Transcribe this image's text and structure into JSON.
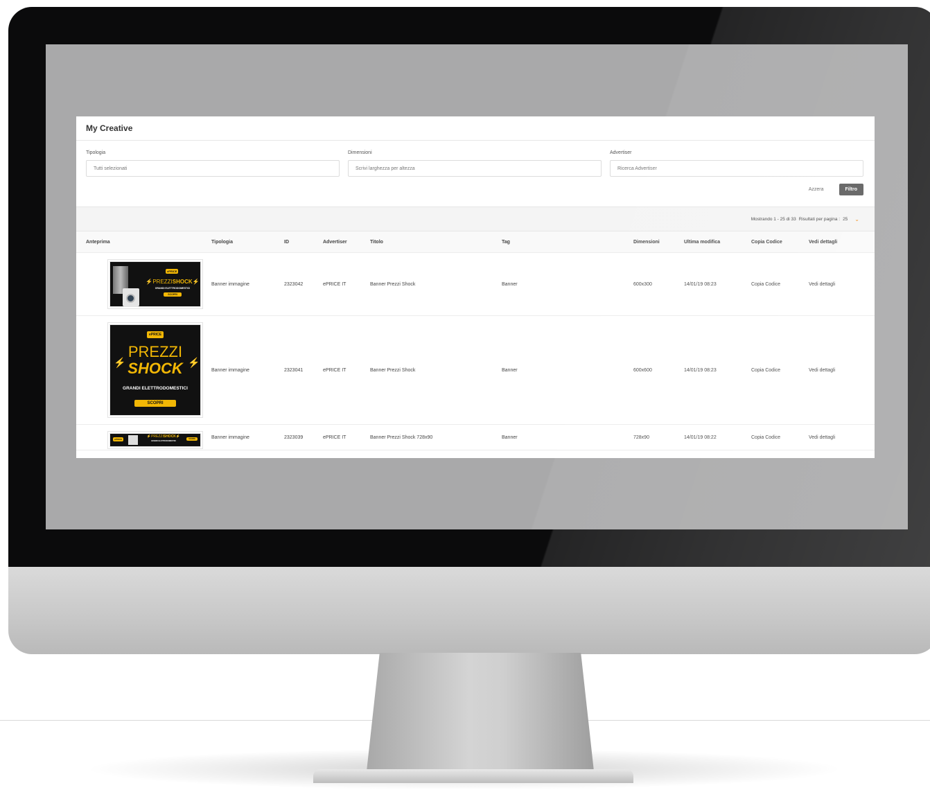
{
  "app": {
    "title": "My Creative"
  },
  "filters": {
    "tipologia": {
      "label": "Tipologia",
      "placeholder": "Tutti selezionati"
    },
    "dimensioni": {
      "label": "Dimensioni",
      "placeholder": "Scrivi larghezza per altezza"
    },
    "advertiser": {
      "label": "Advertiser",
      "placeholder": "Ricerca Advertiser"
    },
    "reset_label": "Azzera",
    "filter_label": "Filtro"
  },
  "pager": {
    "showing": "Mostrando 1 - 25 di 33",
    "per_page_label": "Risultati per pagina :",
    "per_page_value": "25"
  },
  "columns": [
    "Anteprima",
    "Tipologia",
    "ID",
    "Advertiser",
    "Titolo",
    "Tag",
    "Dimensioni",
    "Ultima modifica",
    "Copia Codice",
    "Vedi dettagli"
  ],
  "rows": [
    {
      "tipologia": "Banner immagine",
      "id": "2323042",
      "advertiser": "ePRICE IT",
      "titolo": "Banner Prezzi Shock",
      "tag": "Banner",
      "dimensioni": "600x300",
      "modifica": "14/01/19 08:23",
      "copia": "Copia Codice",
      "dettagli": "Vedi dettagli"
    },
    {
      "tipologia": "Banner immagine",
      "id": "2323041",
      "advertiser": "ePRICE IT",
      "titolo": "Banner Prezzi Shock",
      "tag": "Banner",
      "dimensioni": "600x600",
      "modifica": "14/01/19 08:23",
      "copia": "Copia Codice",
      "dettagli": "Vedi dettagli"
    },
    {
      "tipologia": "Banner immagine",
      "id": "2323039",
      "advertiser": "ePRICE IT",
      "titolo": "Banner Prezzi Shock 728x90",
      "tag": "Banner",
      "dimensioni": "728x90",
      "modifica": "14/01/19 08:22",
      "copia": "Copia Codice",
      "dettagli": "Vedi dettagli"
    }
  ],
  "banner": {
    "logo": "ePRICE",
    "prezzi": "PREZZI",
    "shock": "SHOCK",
    "subtitle": "GRANDI ELETTRODOMESTICI",
    "cta": "SCOPRI"
  },
  "colors": {
    "accent": "#f28c18",
    "banner_yellow": "#f2b705",
    "button": "#5d5d5d"
  }
}
